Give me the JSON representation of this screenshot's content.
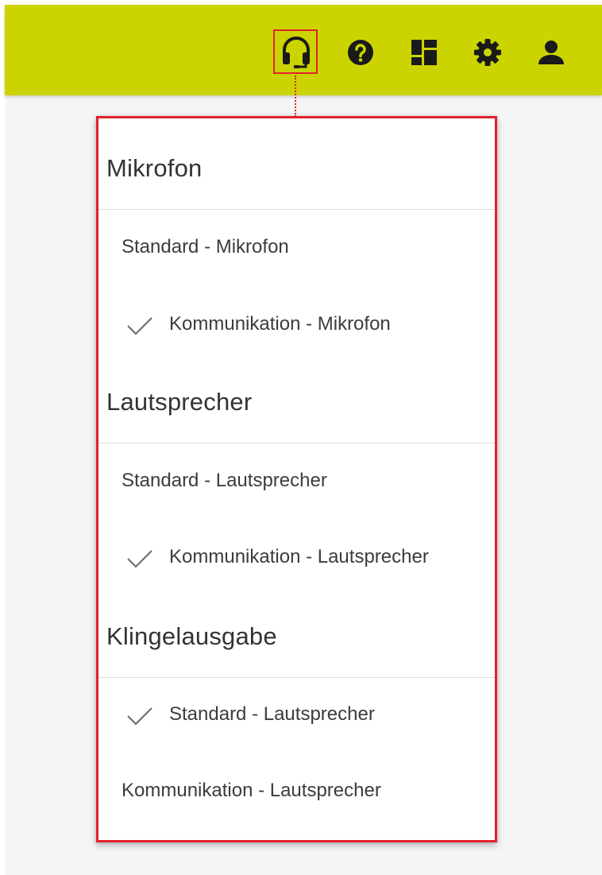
{
  "header": {
    "background_color": "#cbd400",
    "icons": [
      "headset-icon",
      "help-icon",
      "dashboard-icon",
      "gear-icon",
      "user-icon"
    ]
  },
  "highlight_color": "#e1222b",
  "dropdown": {
    "sections": [
      {
        "title": "Mikrofon",
        "options": [
          {
            "label": "Standard - Mikrofon",
            "selected": false
          },
          {
            "label": "Kommunikation - Mikrofon",
            "selected": true
          }
        ]
      },
      {
        "title": "Lautsprecher",
        "options": [
          {
            "label": "Standard - Lautsprecher",
            "selected": false
          },
          {
            "label": "Kommunikation - Lautsprecher",
            "selected": true
          }
        ]
      },
      {
        "title": "Klingelausgabe",
        "options": [
          {
            "label": "Standard - Lautsprecher",
            "selected": true
          },
          {
            "label": "Kommunikation - Lautsprecher",
            "selected": false
          }
        ]
      }
    ]
  }
}
